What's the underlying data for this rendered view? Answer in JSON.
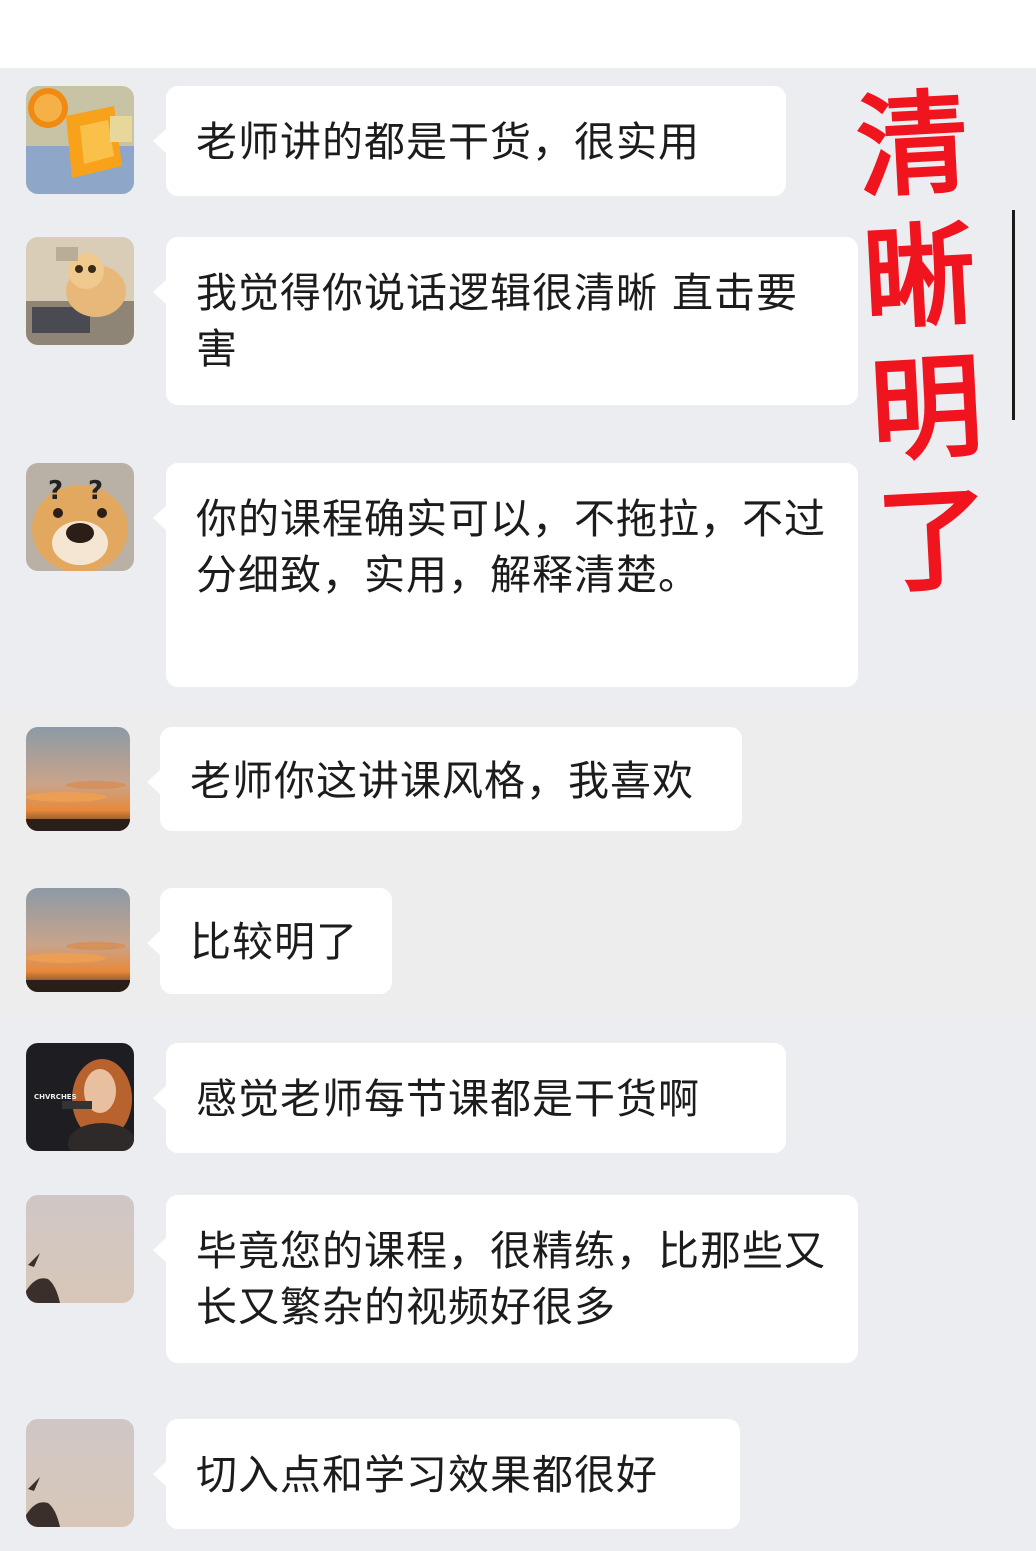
{
  "messages": [
    {
      "text": "老师讲的都是干货，很实用",
      "avatar": "orange-popsicle-avatar"
    },
    {
      "text": "我觉得你说话逻辑很清晰 直击要害",
      "avatar": "cat-laptop-avatar"
    },
    {
      "text": "你的课程确实可以，不拖拉，不过分细致，实用，解释清楚。",
      "avatar": "dog-question-avatar"
    },
    {
      "text": "老师你这讲课风格，我喜欢",
      "avatar": "sunset-sky-avatar"
    },
    {
      "text": "比较明了",
      "avatar": "sunset-sky-avatar"
    },
    {
      "text": "感觉老师每节课都是干货啊",
      "avatar": "singer-photo-avatar"
    },
    {
      "text": "毕竟您的课程，很精练，比那些又长又繁杂的视频好很多",
      "avatar": "pale-sky-avatar"
    },
    {
      "text": "切入点和学习效果都很好",
      "avatar": "pale-sky-avatar"
    }
  ],
  "stamp": {
    "text": "清晰明了",
    "color": "#f0141e"
  },
  "avatar_badge": "CHVRCHES",
  "colors": {
    "chat_bg": "#ededed",
    "bubble_bg": "#ffffff",
    "text": "#1c1c1c"
  }
}
